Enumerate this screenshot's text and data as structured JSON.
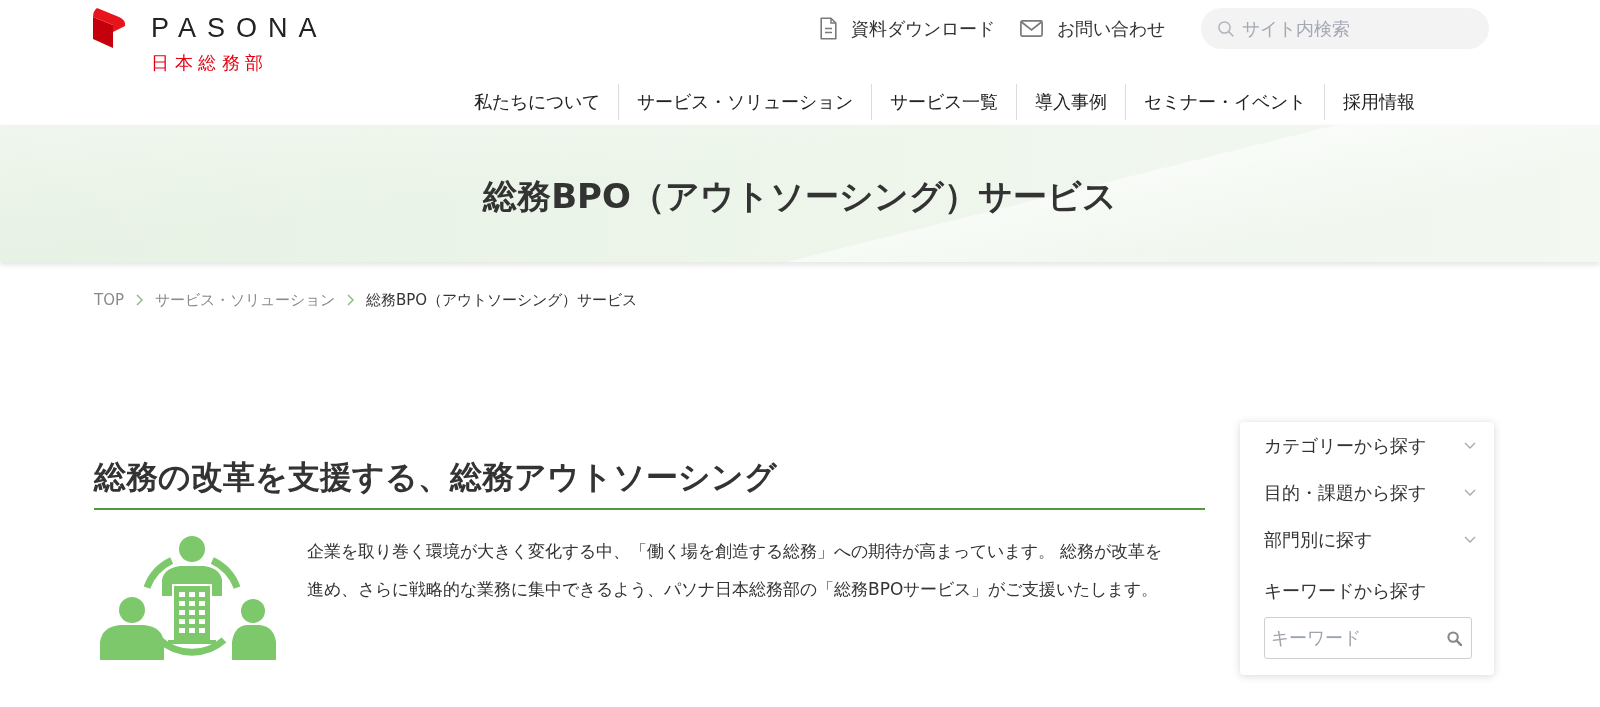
{
  "header": {
    "logo": {
      "wordmark": "PASONA",
      "subtitle": "日本総務部"
    },
    "utility_links": [
      {
        "kind": "document",
        "label": "資料ダウンロード"
      },
      {
        "kind": "mail",
        "label": "お問い合わせ"
      }
    ],
    "search": {
      "placeholder": "サイト内検索"
    }
  },
  "nav": {
    "items": [
      {
        "label": "私たちについて"
      },
      {
        "label": "サービス・ソリューション"
      },
      {
        "label": "サービス一覧"
      },
      {
        "label": "導入事例"
      },
      {
        "label": "セミナー・イベント"
      },
      {
        "label": "採用情報"
      }
    ]
  },
  "hero": {
    "title": "総務BPO（アウトソーシング）サービス"
  },
  "breadcrumb": [
    {
      "label": "TOP",
      "current": false
    },
    {
      "label": "サービス・ソリューション",
      "current": false
    },
    {
      "label": "総務BPO（アウトソーシング）サービス",
      "current": true
    }
  ],
  "intro": {
    "heading": "総務の改革を支援する、総務アウトソーシング",
    "text": "企業を取り巻く環境が大きく変化する中、「働く場を創造する総務」への期待が高まっています。 総務が改革を進め、さらに戦略的な業務に集中できるよう、パソナ日本総務部の「総務BPOサービス」がご支援いたします。"
  },
  "sidebar": {
    "menus": [
      {
        "label": "カテゴリーから探す",
        "expanded": false
      },
      {
        "label": "目的・課題から探す",
        "expanded": false
      },
      {
        "label": "部門別に探す",
        "expanded": false
      }
    ],
    "keyword": {
      "label": "キーワードから探す",
      "placeholder": "キーワード"
    }
  }
}
